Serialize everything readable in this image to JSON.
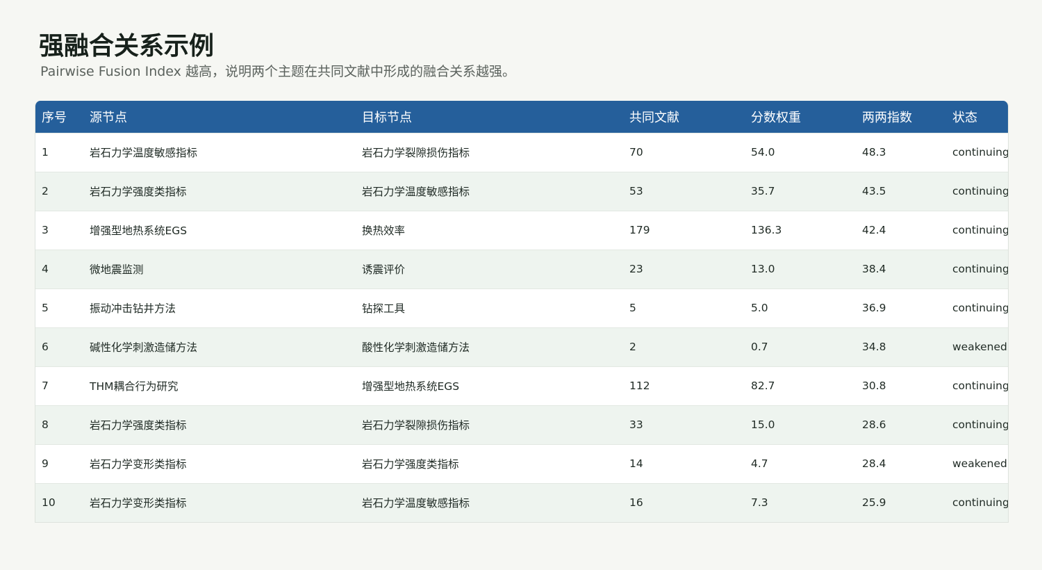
{
  "title": "强融合关系示例",
  "subtitle": "Pairwise Fusion Index 越高，说明两个主题在共同文献中形成的融合关系越强。",
  "colors": {
    "header_bg": "#255f9b",
    "header_text": "#ffffff",
    "row_alt": "#eef4ef",
    "page_bg": "#f6f7f3"
  },
  "table": {
    "columns": [
      "序号",
      "源节点",
      "目标节点",
      "共同文献",
      "分数权重",
      "两两指数",
      "状态"
    ],
    "rows": [
      [
        "1",
        "岩石力学温度敏感指标",
        "岩石力学裂隙损伤指标",
        "70",
        "54.0",
        "48.3",
        "continuing"
      ],
      [
        "2",
        "岩石力学强度类指标",
        "岩石力学温度敏感指标",
        "53",
        "35.7",
        "43.5",
        "continuing"
      ],
      [
        "3",
        "增强型地热系统EGS",
        "换热效率",
        "179",
        "136.3",
        "42.4",
        "continuing"
      ],
      [
        "4",
        "微地震监测",
        "诱震评价",
        "23",
        "13.0",
        "38.4",
        "continuing"
      ],
      [
        "5",
        "振动冲击钻井方法",
        "钻探工具",
        "5",
        "5.0",
        "36.9",
        "continuing"
      ],
      [
        "6",
        "碱性化学刺激造储方法",
        "酸性化学刺激造储方法",
        "2",
        "0.7",
        "34.8",
        "weakened"
      ],
      [
        "7",
        "THM耦合行为研究",
        "增强型地热系统EGS",
        "112",
        "82.7",
        "30.8",
        "continuing"
      ],
      [
        "8",
        "岩石力学强度类指标",
        "岩石力学裂隙损伤指标",
        "33",
        "15.0",
        "28.6",
        "continuing"
      ],
      [
        "9",
        "岩石力学变形类指标",
        "岩石力学强度类指标",
        "14",
        "4.7",
        "28.4",
        "weakened"
      ],
      [
        "10",
        "岩石力学变形类指标",
        "岩石力学温度敏感指标",
        "16",
        "7.3",
        "25.9",
        "continuing"
      ]
    ]
  }
}
